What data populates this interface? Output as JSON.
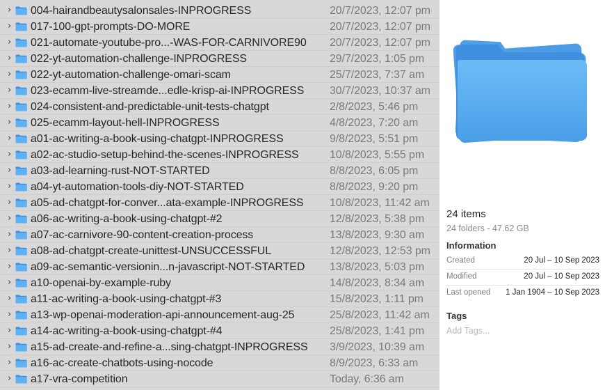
{
  "files": [
    {
      "name": "004-hairandbeautysalonsales-INPROGRESS",
      "date": "20/7/2023, 12:07 pm"
    },
    {
      "name": "017-100-gpt-prompts-DO-MORE",
      "date": "20/7/2023, 12:07 pm"
    },
    {
      "name": "021-automate-youtube-pro...-WAS-FOR-CARNIVORE90",
      "date": "20/7/2023, 12:07 pm"
    },
    {
      "name": "022-yt-automation-challenge-INPROGRESS",
      "date": "29/7/2023, 1:05 pm"
    },
    {
      "name": "022-yt-automation-challenge-omari-scam",
      "date": "25/7/2023, 7:37 am"
    },
    {
      "name": "023-ecamm-live-streamde...edle-krisp-ai-INPROGRESS",
      "date": "30/7/2023, 10:37 am"
    },
    {
      "name": "024-consistent-and-predictable-unit-tests-chatgpt",
      "date": "2/8/2023, 5:46 pm"
    },
    {
      "name": "025-ecamm-layout-hell-INPROGRESS",
      "date": "4/8/2023, 7:20 am"
    },
    {
      "name": "a01-ac-writing-a-book-using-chatgpt-INPROGRESS",
      "date": "9/8/2023, 5:51 pm"
    },
    {
      "name": "a02-ac-studio-setup-behind-the-scenes-INPROGRESS",
      "date": "10/8/2023, 5:55 pm"
    },
    {
      "name": "a03-ad-learning-rust-NOT-STARTED",
      "date": "8/8/2023, 6:05 pm"
    },
    {
      "name": "a04-yt-automation-tools-diy-NOT-STARTED",
      "date": "8/8/2023, 9:20 pm"
    },
    {
      "name": "a05-ad-chatgpt-for-conver...ata-example-INPROGRESS",
      "date": "10/8/2023, 11:42 am"
    },
    {
      "name": "a06-ac-writing-a-book-using-chatgpt-#2",
      "date": "12/8/2023, 5:38 pm"
    },
    {
      "name": "a07-ac-carnivore-90-content-creation-process",
      "date": "13/8/2023, 9:30 am"
    },
    {
      "name": "a08-ad-chatgpt-create-unittest-UNSUCCESSFUL",
      "date": "12/8/2023, 12:53 pm"
    },
    {
      "name": "a09-ac-semantic-versionin...n-javascript-NOT-STARTED",
      "date": "13/8/2023, 5:03 pm"
    },
    {
      "name": "a10-openai-by-example-ruby",
      "date": "14/8/2023, 8:34 am"
    },
    {
      "name": "a11-ac-writing-a-book-using-chatgpt-#3",
      "date": "15/8/2023, 1:11 pm"
    },
    {
      "name": "a13-wp-openai-moderation-api-announcement-aug-25",
      "date": "25/8/2023, 11:42 am"
    },
    {
      "name": "a14-ac-writing-a-book-using-chatgpt-#4",
      "date": "25/8/2023, 1:41 pm"
    },
    {
      "name": "a15-ad-create-and-refine-a...sing-chatgpt-INPROGRESS",
      "date": "3/9/2023, 10:39 am"
    },
    {
      "name": "a16-ac-create-chatbots-using-nocode",
      "date": "8/9/2023, 6:33 am"
    },
    {
      "name": "a17-vra-competition",
      "date": "Today, 6:36 am"
    }
  ],
  "info": {
    "items_count": "24 items",
    "items_sub": "24 folders - 47.62 GB",
    "information_title": "Information",
    "created_label": "Created",
    "created_value": "20 Jul – 10 Sep 2023",
    "modified_label": "Modified",
    "modified_value": "20 Jul – 10 Sep 2023",
    "last_opened_label": "Last opened",
    "last_opened_value": "1 Jan 1904 – 10 Sep 2023",
    "tags_title": "Tags",
    "add_tags_placeholder": "Add Tags..."
  },
  "colors": {
    "selection_bg": "#d8d8d8",
    "folder_blue": "#5eb2f4",
    "folder_blue_dark": "#3f8fdd"
  },
  "icons": {
    "row_chevron": "chevron-right-icon",
    "row_folder": "folder-icon",
    "preview": "folder-icon"
  }
}
